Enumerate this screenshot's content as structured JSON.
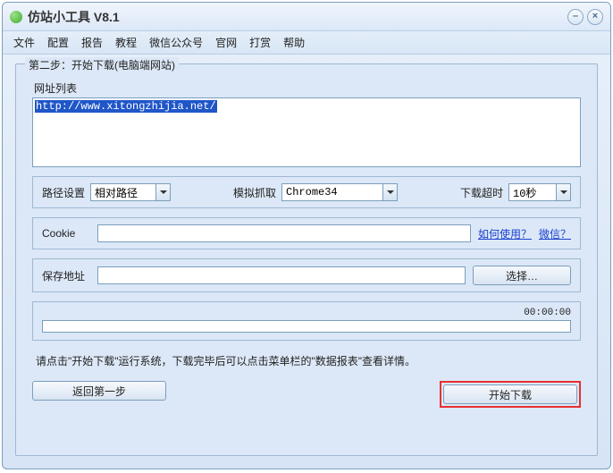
{
  "window": {
    "title": "仿站小工具 V8.1"
  },
  "menu": {
    "file": "文件",
    "config": "配置",
    "report": "报告",
    "tutorial": "教程",
    "wechat": "微信公众号",
    "official": "官网",
    "donate": "打赏",
    "help": "帮助"
  },
  "group": {
    "legend": "第二步：开始下载(电脑端网站)"
  },
  "url": {
    "label": "网址列表",
    "selected": "http://www.xitongzhijia.net/"
  },
  "settings": {
    "path_label": "路径设置",
    "path_value": "相对路径",
    "grab_label": "模拟抓取",
    "grab_value": "Chrome34",
    "timeout_label": "下载超时",
    "timeout_value": "10秒"
  },
  "cookie": {
    "label": "Cookie",
    "value": "",
    "howto_link": "如何使用？",
    "wechat_link": "微信？"
  },
  "save": {
    "label": "保存地址",
    "value": "",
    "browse_btn": "选择…"
  },
  "progress": {
    "time": "00:00:00"
  },
  "hint": "请点击\"开始下载\"运行系统，下载完毕后可以点击菜单栏的\"数据报表\"查看详情。",
  "buttons": {
    "back": "返回第一步",
    "start": "开始下载"
  }
}
